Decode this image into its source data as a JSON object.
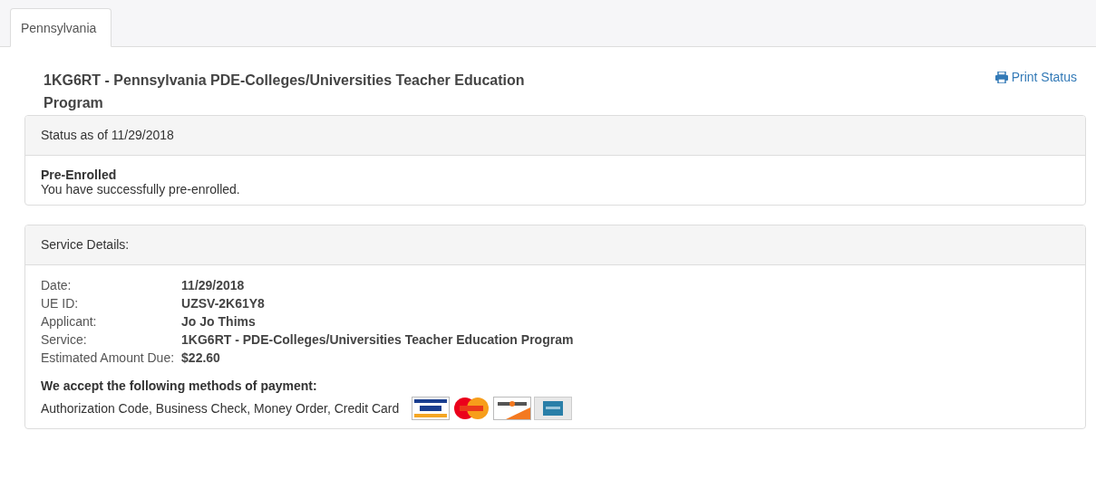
{
  "tabs": [
    {
      "label": "Pennsylvania",
      "selected": true
    }
  ],
  "title": "1KG6RT - Pennsylvania PDE-Colleges/Universities Teacher Education Program",
  "print_link": "Print Status",
  "status_panel": {
    "heading": "Status as of 11/29/2018",
    "status": "Pre-Enrolled",
    "message": "You have successfully pre-enrolled."
  },
  "details_panel": {
    "heading": "Service Details:",
    "rows": [
      {
        "label": "Date:",
        "value": "11/29/2018"
      },
      {
        "label": "UE ID:",
        "value": "UZSV-2K61Y8"
      },
      {
        "label": "Applicant:",
        "value": "Jo Jo Thims"
      },
      {
        "label": "Service:",
        "value": "1KG6RT - PDE-Colleges/Universities Teacher Education Program"
      },
      {
        "label": "Estimated Amount Due:",
        "value": "$22.60"
      }
    ],
    "payment_heading": "We accept the following methods of payment:",
    "payment_methods": "Authorization Code, Business Check, Money Order, Credit Card",
    "cards": [
      {
        "kind": "visa"
      },
      {
        "kind": "mastercard"
      },
      {
        "kind": "discover"
      },
      {
        "kind": "amex"
      }
    ]
  }
}
